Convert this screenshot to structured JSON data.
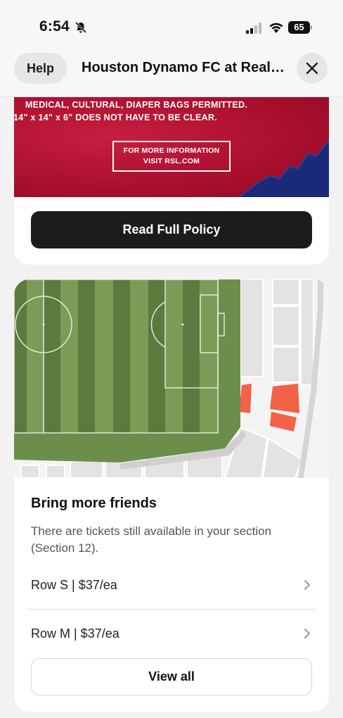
{
  "status_bar": {
    "time": "6:54",
    "battery": "65"
  },
  "header": {
    "help_label": "Help",
    "title": "Houston Dynamo FC at Real Salt Lake"
  },
  "policy": {
    "banner_line_1": "MEDICAL, CULTURAL, DIAPER BAGS PERMITTED.",
    "banner_line_2": "14\" x 14\" x 6\" DOES NOT HAVE TO BE CLEAR.",
    "banner_info_line_1": "FOR MORE INFORMATION",
    "banner_info_line_2": "VISIT RSL.COM",
    "read_button_label": "Read Full Policy"
  },
  "friends": {
    "title": "Bring more friends",
    "description": "There are tickets still available in your section (Section 12).",
    "rows": [
      {
        "label": "Row S | $37/ea"
      },
      {
        "label": "Row M | $37/ea"
      }
    ],
    "view_all_label": "View all"
  },
  "colors": {
    "banner_red": "#b5143a",
    "banner_navy": "#1a2a78",
    "pitch_green": "#6b8f4a",
    "highlight_section": "#f26148",
    "button_dark": "#1c1c1e"
  }
}
